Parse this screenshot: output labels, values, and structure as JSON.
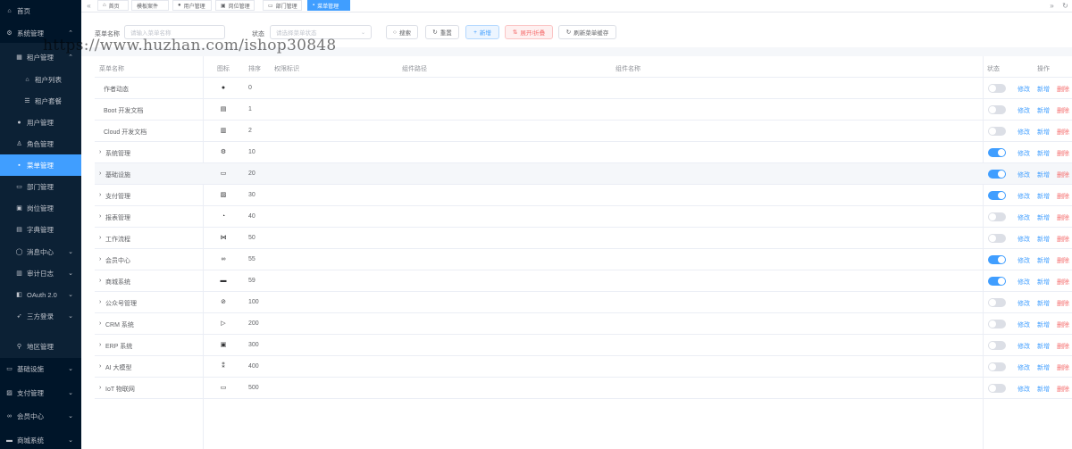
{
  "sidebar": {
    "home": "首页",
    "system": "系统管理",
    "tenant": "租户管理",
    "tenant_list": "租户列表",
    "tenant_package": "租户套餐",
    "user": "用户管理",
    "role": "角色管理",
    "menu": "菜单管理",
    "dept": "部门管理",
    "post": "岗位管理",
    "dict": "字典管理",
    "message": "消息中心",
    "audit": "审计日志",
    "oauth": "OAuth 2.0",
    "social": "三方登录",
    "area": "地区管理",
    "infra": "基础设施",
    "pay": "支付管理",
    "member": "会员中心",
    "mall": "商城系统"
  },
  "tabs": [
    "首页",
    "模板案件",
    "用户管理",
    "岗位管理",
    "部门管理",
    "菜单管理"
  ],
  "search": {
    "name_label": "菜单名称",
    "name_placeholder": "请输入菜单名称",
    "status_label": "状态",
    "status_placeholder": "请选择菜单状态",
    "btn_search": "搜索",
    "btn_reset": "重置",
    "btn_add": "新增",
    "btn_expand": "展开/折叠",
    "btn_refresh": "刷新菜单缓存"
  },
  "table": {
    "headers": {
      "name": "菜单名称",
      "icon": "图标",
      "sort": "排序",
      "perm": "权限标识",
      "component": "组件路径",
      "component_name": "组件名称",
      "status": "状态",
      "actions": "操作"
    },
    "action_edit": "修改",
    "action_add": "新增",
    "action_delete": "删除",
    "rows": [
      {
        "name": "作者动态",
        "icon": "user-icon",
        "sort": "0",
        "status_on": false,
        "expandable": false
      },
      {
        "name": "Boot 开发文档",
        "icon": "document-icon",
        "sort": "1",
        "status_on": false,
        "expandable": false
      },
      {
        "name": "Cloud 开发文档",
        "icon": "copy-document-icon",
        "sort": "2",
        "status_on": false,
        "expandable": false
      },
      {
        "name": "系统管理",
        "icon": "gear-icon",
        "sort": "10",
        "status_on": true,
        "expandable": true
      },
      {
        "name": "基础设施",
        "icon": "monitor-icon",
        "sort": "20",
        "status_on": true,
        "expandable": true
      },
      {
        "name": "支付管理",
        "icon": "wallet-icon",
        "sort": "30",
        "status_on": true,
        "expandable": true
      },
      {
        "name": "报表管理",
        "icon": "pie-chart-icon",
        "sort": "40",
        "status_on": false,
        "expandable": true
      },
      {
        "name": "工作流程",
        "icon": "workflow-icon",
        "sort": "50",
        "status_on": false,
        "expandable": true
      },
      {
        "name": "会员中心",
        "icon": "bicycle-icon",
        "sort": "55",
        "status_on": true,
        "expandable": true
      },
      {
        "name": "商城系统",
        "icon": "store-icon",
        "sort": "59",
        "status_on": true,
        "expandable": true
      },
      {
        "name": "公众号管理",
        "icon": "compass-icon",
        "sort": "100",
        "status_on": false,
        "expandable": true
      },
      {
        "name": "CRM 系统",
        "icon": "crm-icon",
        "sort": "200",
        "status_on": false,
        "expandable": true
      },
      {
        "name": "ERP 系统",
        "icon": "erp-icon",
        "sort": "300",
        "status_on": false,
        "expandable": true
      },
      {
        "name": "AI 大模型",
        "icon": "ai-icon",
        "sort": "400",
        "status_on": false,
        "expandable": true
      },
      {
        "name": "IoT 物联网",
        "icon": "iot-icon",
        "sort": "500",
        "status_on": false,
        "expandable": true
      }
    ]
  },
  "watermark": "https://www.huzhan.com/ishop30848",
  "colors": {
    "primary": "#409eff",
    "danger": "#f56c6c",
    "sidebar_bg": "#001529"
  }
}
